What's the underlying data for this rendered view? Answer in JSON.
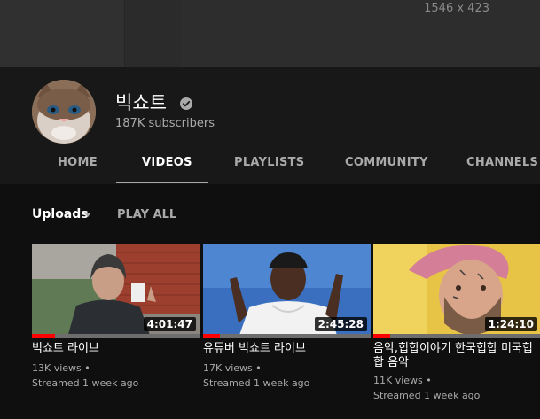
{
  "banner": {
    "dimensions_label": "1546 x 423"
  },
  "channel": {
    "name": "빅쇼트",
    "subscribers": "187K subscribers",
    "verified_icon": "verified-checkmark-icon",
    "avatar_icon": "grumpy-cat-avatar"
  },
  "tabs": [
    {
      "label": "HOME"
    },
    {
      "label": "VIDEOS"
    },
    {
      "label": "PLAYLISTS"
    },
    {
      "label": "COMMUNITY"
    },
    {
      "label": "CHANNELS"
    }
  ],
  "active_tab": "VIDEOS",
  "section": {
    "title": "Uploads",
    "play_all": "PLAY ALL"
  },
  "videos": [
    {
      "title": "빅쇼트 라이브",
      "duration": "4:01:47",
      "views": "13K views •",
      "streamed": "Streamed 1 week ago",
      "progress_pct": 14
    },
    {
      "title": "유튜버 빅쇼트 라이브",
      "duration": "2:45:28",
      "views": "17K views •",
      "streamed": "Streamed 1 week ago",
      "progress_pct": 10
    },
    {
      "title": "음악,힙합이야기 한국힙합 미국힙합 음악",
      "duration": "1:24:10",
      "views": "11K views •",
      "streamed": "Streamed 1 week ago",
      "progress_pct": 10
    }
  ],
  "colors": {
    "accent": "#ff0000",
    "background": "#0f0f0f",
    "header": "#181818",
    "muted_text": "#aaaaaa"
  }
}
